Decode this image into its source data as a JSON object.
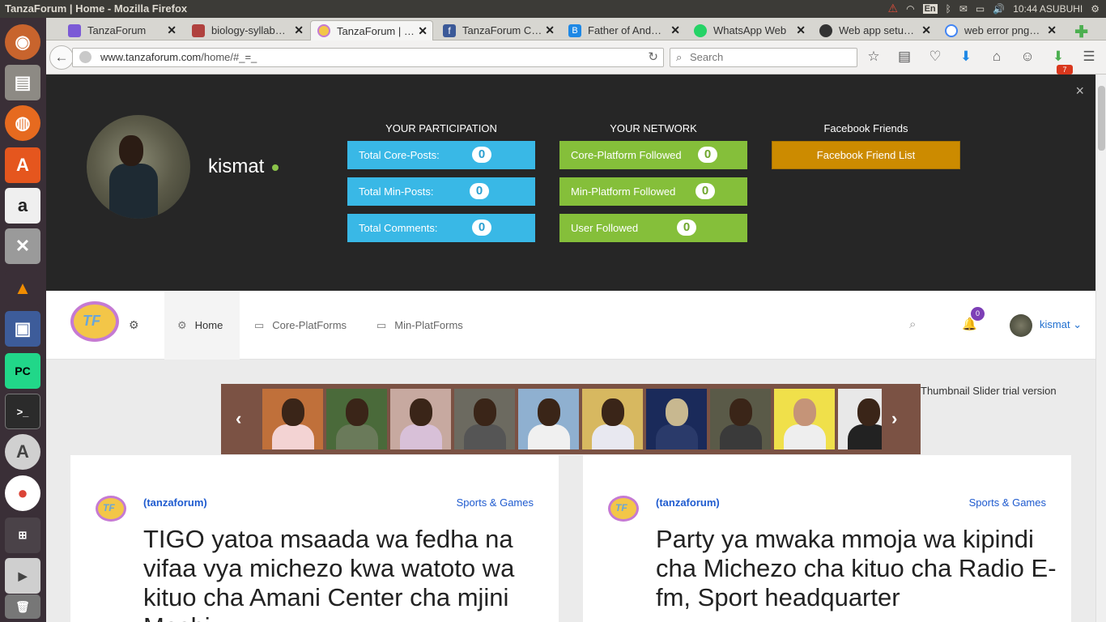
{
  "window": {
    "title": "TanzaForum | Home - Mozilla Firefox",
    "clock": "10:44 ASUBUHI",
    "keyboard": "En"
  },
  "tabs": [
    {
      "label": "TanzaForum",
      "fav": "#7b5ad6"
    },
    {
      "label": "biology-syllab…",
      "fav": "#b0413e"
    },
    {
      "label": "TanzaForum | …",
      "fav": "#f3c648"
    },
    {
      "label": "TanzaForum C…",
      "fav": "#3b5998"
    },
    {
      "label": "Father of And…",
      "fav": "#1e88e5"
    },
    {
      "label": "WhatsApp Web",
      "fav": "#25d366"
    },
    {
      "label": "Web app setu…",
      "fav": "#333333"
    },
    {
      "label": "web error png…",
      "fav": "#4285f4"
    }
  ],
  "nav": {
    "url_host": "www.tanzaforum.com",
    "url_path": "/home/#_=_",
    "search_placeholder": "Search",
    "download_badge": "7"
  },
  "profile": {
    "username": "kismat",
    "participation_title": "YOUR PARTICIPATION",
    "network_title": "YOUR NETWORK",
    "facebook_title": "Facebook Friends",
    "facebook_button": "Facebook Friend List",
    "participation": [
      {
        "label": "Total Core-Posts:",
        "count": "0"
      },
      {
        "label": "Total Min-Posts:",
        "count": "0"
      },
      {
        "label": "Total Comments:",
        "count": "0"
      }
    ],
    "network": [
      {
        "label": "Core-Platform Followed",
        "count": "0"
      },
      {
        "label": "Min-Platform Followed",
        "count": "0"
      },
      {
        "label": "User Followed",
        "count": "0"
      }
    ]
  },
  "site": {
    "logo_text": "TF",
    "menu": [
      {
        "label": "Home"
      },
      {
        "label": "Core-PlatForms"
      },
      {
        "label": "Min-PlatForms"
      }
    ],
    "notifications": "0",
    "user": "kismat"
  },
  "slider": {
    "trial_text": "Thumbnail Slider trial version",
    "thumb_colors": [
      "#c0703a",
      "#4a6a3a",
      "#c7a9a0",
      "#6c6a60",
      "#8fb0d0",
      "#d7b860",
      "#1a2a5a",
      "#5a5a48",
      "#f0e04a",
      "#e8e8e8"
    ]
  },
  "posts": [
    {
      "source": "(tanzaforum)",
      "category": "Sports & Games",
      "title": "TIGO yatoa msaada wa fedha na vifaa vya michezo kwa watoto wa kituo cha Amani Center cha mjini Moshi"
    },
    {
      "source": "(tanzaforum)",
      "category": "Sports & Games",
      "title": "Party ya mwaka mmoja wa kipindi cha Michezo cha kituo cha Radio E-fm, Sport headquarter"
    }
  ]
}
